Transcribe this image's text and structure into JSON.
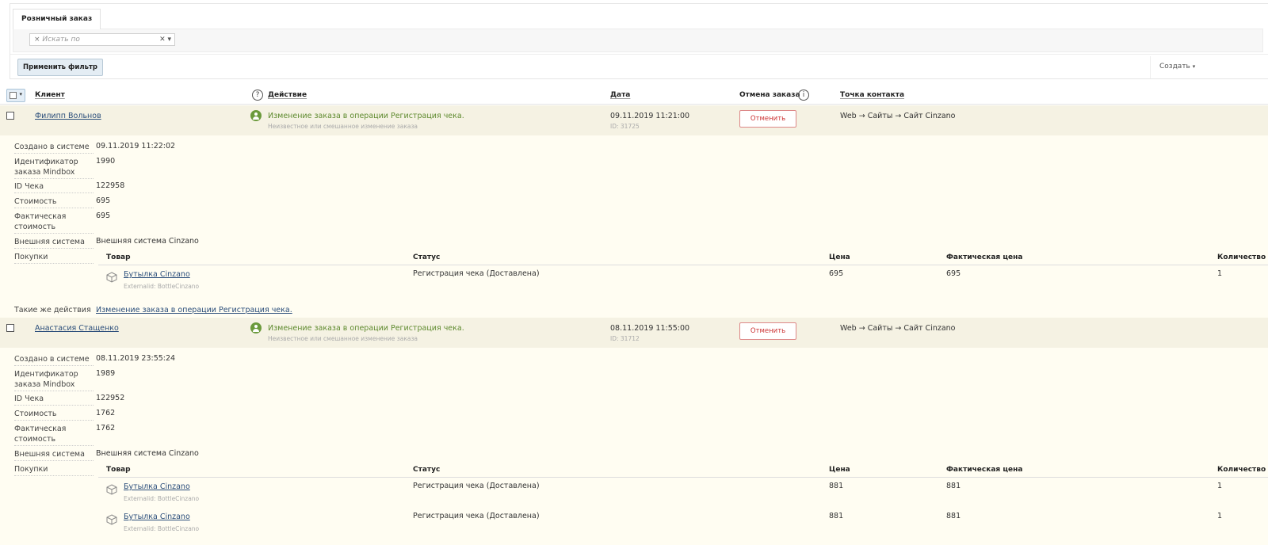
{
  "filter": {
    "tab_label": "Розничный заказ",
    "search_placeholder": "Искать по",
    "search_prefix": "×",
    "apply_label": "Применить фильтр",
    "create_label": "Создать"
  },
  "table": {
    "headers": {
      "client": "Клиент",
      "action": "Действие",
      "date": "Дата",
      "cancel": "Отмена заказа",
      "contact": "Точка контакта"
    },
    "purchase_headers": {
      "product": "Товар",
      "status": "Статус",
      "price": "Цена",
      "actual_price": "Фактическая цена",
      "quantity": "Количество"
    },
    "labels": {
      "created": "Создано в системе",
      "mindbox_id": "Идентификатор заказа Mindbox",
      "receipt_id": "ID Чека",
      "cost": "Стоимость",
      "actual_cost": "Фактическая стоимость",
      "external_system": "Внешняя система",
      "purchases": "Покупки",
      "same_actions": "Такие же действия",
      "cancel_button": "Отменить"
    }
  },
  "orders": [
    {
      "client": "Филипп Вольнов",
      "action": "Изменение заказа в операции Регистрация чека.",
      "action_sub": "Неизвестное или смешанное изменение заказа",
      "date": "09.11.2019 11:21:00",
      "id": "ID: 31725",
      "contact": "Web → Сайты → Сайт Cinzano",
      "created": "09.11.2019 11:22:02",
      "mindbox_id": "1990",
      "receipt_id": "122958",
      "cost": "695",
      "actual_cost": "695",
      "external_system": "Внешняя система Cinzano",
      "items": [
        {
          "product": "Бутылка Cinzano",
          "ext": "Externalid: BottleCinzano",
          "status": "Регистрация чека (Доставлена)",
          "price": "695",
          "actual_price": "695",
          "quantity": "1"
        }
      ],
      "same_actions": "Изменение заказа в операции Регистрация чека."
    },
    {
      "client": "Анастасия Стащенко",
      "action": "Изменение заказа в операции Регистрация чека.",
      "action_sub": "Неизвестное или смешанное изменение заказа",
      "date": "08.11.2019 11:55:00",
      "id": "ID: 31712",
      "contact": "Web → Сайты → Сайт Cinzano",
      "created": "08.11.2019 23:55:24",
      "mindbox_id": "1989",
      "receipt_id": "122952",
      "cost": "1762",
      "actual_cost": "1762",
      "external_system": "Внешняя система Cinzano",
      "items": [
        {
          "product": "Бутылка Cinzano",
          "ext": "Externalid: BottleCinzano",
          "status": "Регистрация чека (Доставлена)",
          "price": "881",
          "actual_price": "881",
          "quantity": "1"
        },
        {
          "product": "Бутылка Cinzano",
          "ext": "Externalid: BottleCinzano",
          "status": "Регистрация чека (Доставлена)",
          "price": "881",
          "actual_price": "881",
          "quantity": "1"
        }
      ]
    }
  ],
  "colors": {
    "accent_green": "#5e8a2e",
    "row_highlight": "#f5f2e3",
    "details_bg": "#fffdf2",
    "cancel_red": "#c33"
  }
}
